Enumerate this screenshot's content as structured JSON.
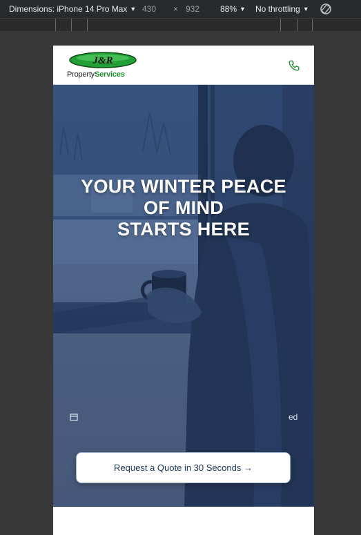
{
  "devtools": {
    "dimensions_label": "Dimensions: iPhone 14 Pro Max",
    "width_value": "430",
    "times_symbol": "×",
    "height_value": "932",
    "zoom": "88%",
    "throttling": "No throttling",
    "rotate_icon": "rotate-icon"
  },
  "site": {
    "logo": {
      "initials": "J&R",
      "word_property": "Property",
      "word_services": "Services"
    },
    "phone_icon": "phone-icon"
  },
  "hero": {
    "title": "YOUR WINTER PEACE\nOF MIND\nSTARTS HERE",
    "badge_right_fragment": "ed",
    "cta_label": "Request a Quote in 30 Seconds →"
  },
  "colors": {
    "brand_green": "#1f8f2e",
    "hero_overlay": "#2c426a",
    "cta_text": "#1e3559"
  }
}
